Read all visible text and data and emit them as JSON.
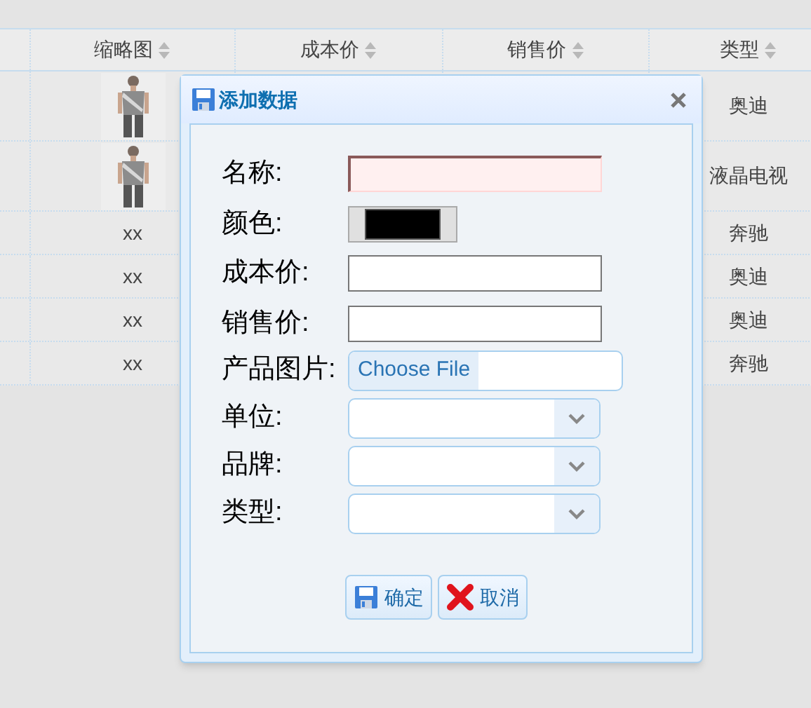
{
  "table": {
    "columns": [
      {},
      {
        "label": "缩略图",
        "sortable": true
      },
      {
        "label": "成本价",
        "sortable": true
      },
      {
        "label": "销售价",
        "sortable": true
      },
      {
        "label": "类型",
        "sortable": true
      }
    ],
    "rows": [
      {
        "type": "奥迪"
      },
      {
        "type": "液晶电视"
      },
      {
        "thumbnail": {
          "kind": "text",
          "text": "xx"
        },
        "type": "奔驰"
      },
      {
        "thumbnail": {
          "kind": "text",
          "text": "xx"
        },
        "type": "奥迪"
      },
      {
        "thumbnail": {
          "kind": "text",
          "text": "xx"
        },
        "type": "奥迪"
      },
      {
        "thumbnail": {
          "kind": "text",
          "text": "xx"
        },
        "type": "奔驰"
      }
    ]
  },
  "dialog": {
    "title": "添加数据",
    "fields": [
      {
        "label": "名称:",
        "kind": "text",
        "invalid": true
      },
      {
        "label": "颜色:",
        "kind": "color",
        "color": "#000000"
      },
      {
        "label": "成本价:",
        "kind": "text",
        "invalid": false
      },
      {
        "label": "销售价:",
        "kind": "text",
        "invalid": false
      },
      {
        "label": "产品图片:",
        "kind": "file",
        "button": "Choose File"
      },
      {
        "label": "单位:",
        "kind": "select"
      },
      {
        "label": "品牌:",
        "kind": "select"
      },
      {
        "label": "类型:",
        "kind": "select"
      }
    ],
    "buttons": [
      {
        "label": "确定",
        "kind": "save"
      },
      {
        "label": "取消",
        "kind": "cancel"
      }
    ]
  }
}
